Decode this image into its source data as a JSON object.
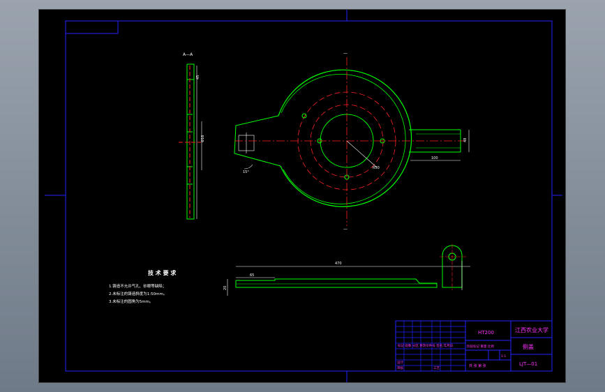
{
  "section_label": "A—A",
  "tech_requirements": {
    "title": "技 术 要 求",
    "items": [
      "1.铸造不允许气孔、砂眼等缺陷；",
      "2.未标注的铸造斜度为1:50mm。",
      "3.未标注的圆角为5mm。"
    ]
  },
  "title_block": {
    "material": "HT200",
    "organization": "江西农业大学",
    "part_name": "侧盖",
    "drawing_no": "LJT—01",
    "scale": "1:1",
    "row_labels": [
      "标记 处数 分区 更改文件号 签名 年月日",
      "设计",
      "审核",
      "工艺"
    ],
    "stage_labels": "阶段标记 重量 比例",
    "sheet_label": "共 张 第 张"
  },
  "dimensions": {
    "top_width": "470",
    "left_offset": "65",
    "radius": "R50",
    "diameter_note": "Φ16",
    "slot_width": "48",
    "slot_length": "100",
    "angle": "15°",
    "section_depth": "45",
    "small_height": "20"
  },
  "colors": {
    "background": "#000000",
    "frame": "#2222ff",
    "part": "#00ff00",
    "centerline": "#ff2222",
    "dimension": "#ffffff",
    "title_text": "#ff33ff"
  }
}
